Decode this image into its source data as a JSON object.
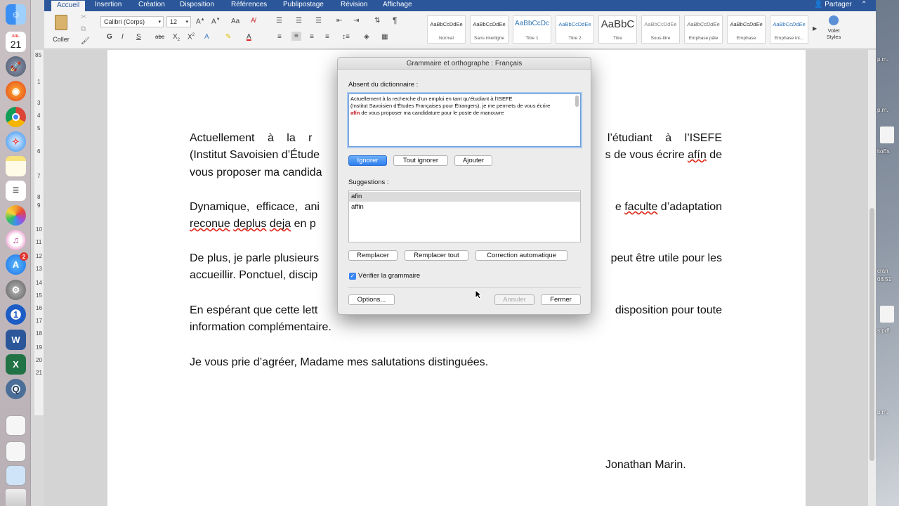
{
  "dock": {
    "calendar_month": "JUIL.",
    "calendar_day": "21",
    "appstore_badge": "2",
    "icons": [
      "finder-icon",
      "calendar-icon",
      "launchpad-icon",
      "firefox-icon",
      "chrome-icon",
      "safari-icon",
      "notes-icon",
      "reminders-icon",
      "photos-icon",
      "itunes-icon",
      "appstore-icon",
      "system-preferences-icon",
      "1password-icon",
      "word-icon",
      "excel-icon",
      "quicktime-icon",
      "downloads-stack-icon",
      "documents-stack-icon",
      "folder-stack-icon",
      "trash-icon"
    ]
  },
  "desktop": {
    "texts": [
      "p.m.",
      "p.m.",
      "itoEs",
      "cran",
      "08.51",
      "s.pdf",
      "p.m."
    ]
  },
  "ribbon": {
    "tabs": [
      "Accueil",
      "Insertion",
      "Création",
      "Disposition",
      "Références",
      "Publipostage",
      "Révision",
      "Affichage"
    ],
    "share_label": "Partager",
    "paste_label": "Coller",
    "font_name": "Calibri (Corps)",
    "font_size": "12",
    "styles": [
      {
        "preview": "AaBbCcDdEe",
        "name": "Normal"
      },
      {
        "preview": "AaBbCcDdEe",
        "name": "Sans interligne"
      },
      {
        "preview": "AaBbCcDc",
        "name": "Titre 1"
      },
      {
        "preview": "AaBbCcDdEe",
        "name": "Titre 2"
      },
      {
        "preview": "AaBbC",
        "name": "Titre"
      },
      {
        "preview": "AaBbCcDdEe",
        "name": "Sous-titre"
      },
      {
        "preview": "AaBbCcDdEe",
        "name": "Emphase pâle"
      },
      {
        "preview": "AaBbCcDdEe",
        "name": "Emphase"
      },
      {
        "preview": "AaBbCcDdEe",
        "name": "Emphase int..."
      }
    ],
    "styles_pane_label_1": "Volet",
    "styles_pane_label_2": "Styles"
  },
  "ruler": [
    "85",
    "1",
    "3",
    "4",
    "5",
    "6",
    "7",
    "8",
    "9",
    "10",
    "11",
    "12",
    "13",
    "14",
    "15",
    "16",
    "17",
    "18",
    "19",
    "20",
    "21"
  ],
  "document": {
    "p1_a": "Actuellement à la r",
    "p1_b": "l’étudiant à l’ISEFE",
    "p1_c": "(Institut Savoisien d’Étude",
    "p1_d": "s de vous écrire ",
    "p1_err": "afín",
    "p1_e": " de",
    "p1_f": "vous proposer ma candida",
    "p2_a": "Dynamique, efficace, ani",
    "p2_b": "e ",
    "p2_err1": "faculte",
    "p2_c": " d’adaptation",
    "p2_err2": "reconue",
    "p2_err3": "deplus",
    "p2_err4": "deja",
    "p2_d": " en p",
    "p3_a": "De plus, je parle plusieurs",
    "p3_b": "peut être utile pour les",
    "p3_c": "accueillir. Ponctuel, discip",
    "p4_a": "En espérant que cette lett",
    "p4_b": "disposition pour toute",
    "p4_c": "information complémentaire.",
    "p5": "Je vous prie d’agréer, Madame mes salutations distinguées.",
    "signature": "Jonathan Marin."
  },
  "dialog": {
    "title": "Grammaire et orthographe : Français",
    "absent_label": "Absent du dictionnaire :",
    "dict_line1": "Actuellement à la recherche d’un emploi en tant qu’étudiant à l’ISEFE",
    "dict_line2": "(Institut Savoisien d’Études Françaises pour Étrangers), je me permets de vous écrire",
    "dict_err": "afín",
    "dict_line3": " de vous proposer ma candidature pour le poste de manouvre",
    "btn_ignore": "Ignorer",
    "btn_ignore_all": "Tout ignorer",
    "btn_add": "Ajouter",
    "suggestions_label": "Suggestions :",
    "suggestions": [
      "afin",
      "affin"
    ],
    "btn_replace": "Remplacer",
    "btn_replace_all": "Remplacer tout",
    "btn_autocorrect": "Correction automatique",
    "check_grammar_label": "Vérifier la grammaire",
    "btn_options": "Options...",
    "btn_cancel": "Annuler",
    "btn_close": "Fermer"
  },
  "colors": {
    "ribbon_blue": "#2b579a",
    "error_red": "#c0101a",
    "primary_button": "#2f7ef0"
  }
}
